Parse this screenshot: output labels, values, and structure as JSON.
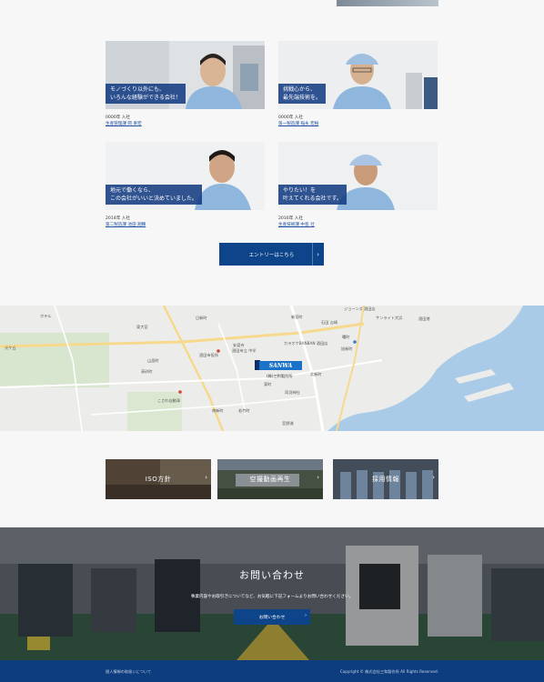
{
  "staff": [
    {
      "caption": "モノづくり以外にも、\nいろんな経験ができる会社！",
      "year": "0000年 入社",
      "dept": "生産管理課 岡 幸宏"
    },
    {
      "caption": "挑戦心から、\n最先端技術を。",
      "year": "0000年 入社",
      "dept": "第一製造課 稲永 宏樹"
    },
    {
      "caption": "地元で働くなら、\nこの会社がいいと決めていました。",
      "year": "2014年 入社",
      "dept": "第二製造課 池田 翔輝"
    },
    {
      "caption": "やりたい！を\n叶えてくれる会社です。",
      "year": "2016年 入社",
      "dept": "生産技術課 中島 壮"
    }
  ],
  "entry_button": "エントリーはこちら",
  "map": {
    "brand": "SANWA",
    "company_label": "(株)三和製作所",
    "labels": [
      "ホテル",
      "東大宮",
      "日新町",
      "安渡寺",
      "新宮町",
      "石田 吉崎",
      "酒田市役所",
      "酒田市立 中学",
      "カラオケBANBAN 酒田店",
      "旭新町",
      "高砂町",
      "南新町",
      "若竹町",
      "北新町",
      "東町",
      "宮野浦",
      "酒田港",
      "サンライト大浜",
      "光ケ丘",
      "山居町",
      "こさわ自動車",
      "両羽神社",
      "ジョーンズ 酒田店",
      "曙町"
    ]
  },
  "cards": [
    {
      "label": "ISO方針"
    },
    {
      "label": "空撮動画再生"
    },
    {
      "label": "採用情報"
    }
  ],
  "contact": {
    "title": "お問い合わせ",
    "text": "事業内容やお取引きについてなど、お気軽に下記フォームよりお問い合わせください。",
    "button": "お問い合わせ"
  },
  "footer": {
    "privacy": "個人情報の取扱いについて",
    "copyright": "Copyright © 株式会社三和製作所 All Rights Reserved."
  }
}
